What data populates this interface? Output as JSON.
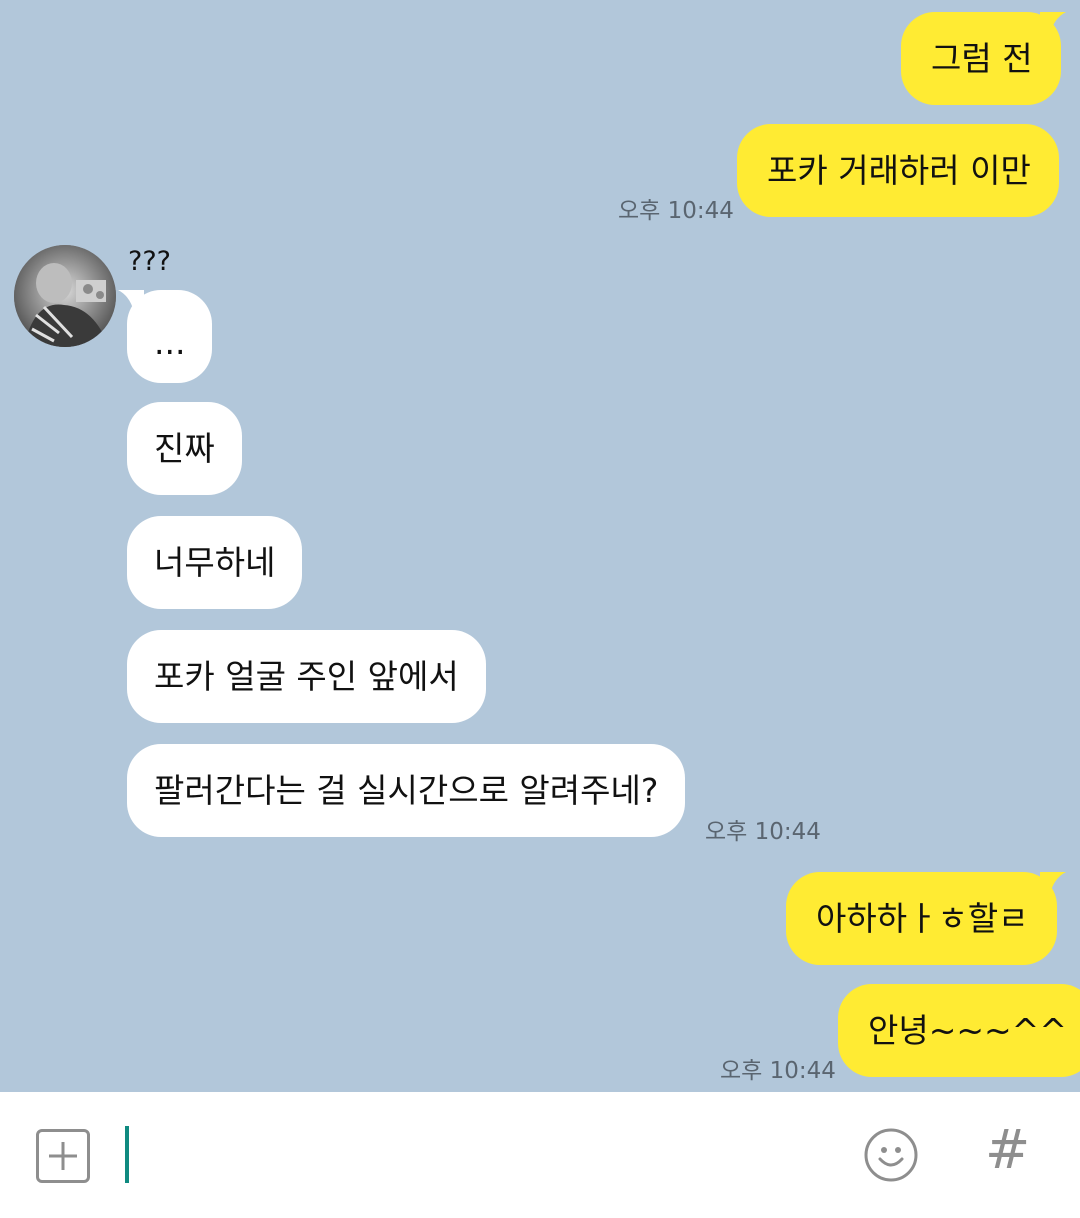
{
  "chat": {
    "messages": [
      {
        "id": "m1",
        "from": "me",
        "text": "그럼 전"
      },
      {
        "id": "m2",
        "from": "me",
        "text": "포카 거래하러 이만",
        "time": "오후 10:44"
      },
      {
        "id": "m3",
        "from": "other",
        "text": "..."
      },
      {
        "id": "m4",
        "from": "other",
        "text": "진짜"
      },
      {
        "id": "m5",
        "from": "other",
        "text": "너무하네"
      },
      {
        "id": "m6",
        "from": "other",
        "text": "포카 얼굴 주인 앞에서"
      },
      {
        "id": "m7",
        "from": "other",
        "text": "팔러간다는 걸 실시간으로 알려주네?",
        "time": "오후 10:44"
      },
      {
        "id": "m8",
        "from": "me",
        "text": "아하하ㅏㅎ할ㄹ"
      },
      {
        "id": "m9",
        "from": "me",
        "text": "안녕~~~^^",
        "time": "오후 10:44"
      }
    ],
    "other_sender": {
      "name": "???"
    }
  },
  "input_bar": {
    "plus_icon": "plus-square-icon",
    "emoji_icon": "smiley-icon",
    "hash_icon": "hash-icon",
    "hash_label": "#"
  },
  "colors": {
    "background": "#b2c7da",
    "my_bubble": "#ffeb33",
    "other_bubble": "#ffffff",
    "cursor": "#0f8a80"
  }
}
